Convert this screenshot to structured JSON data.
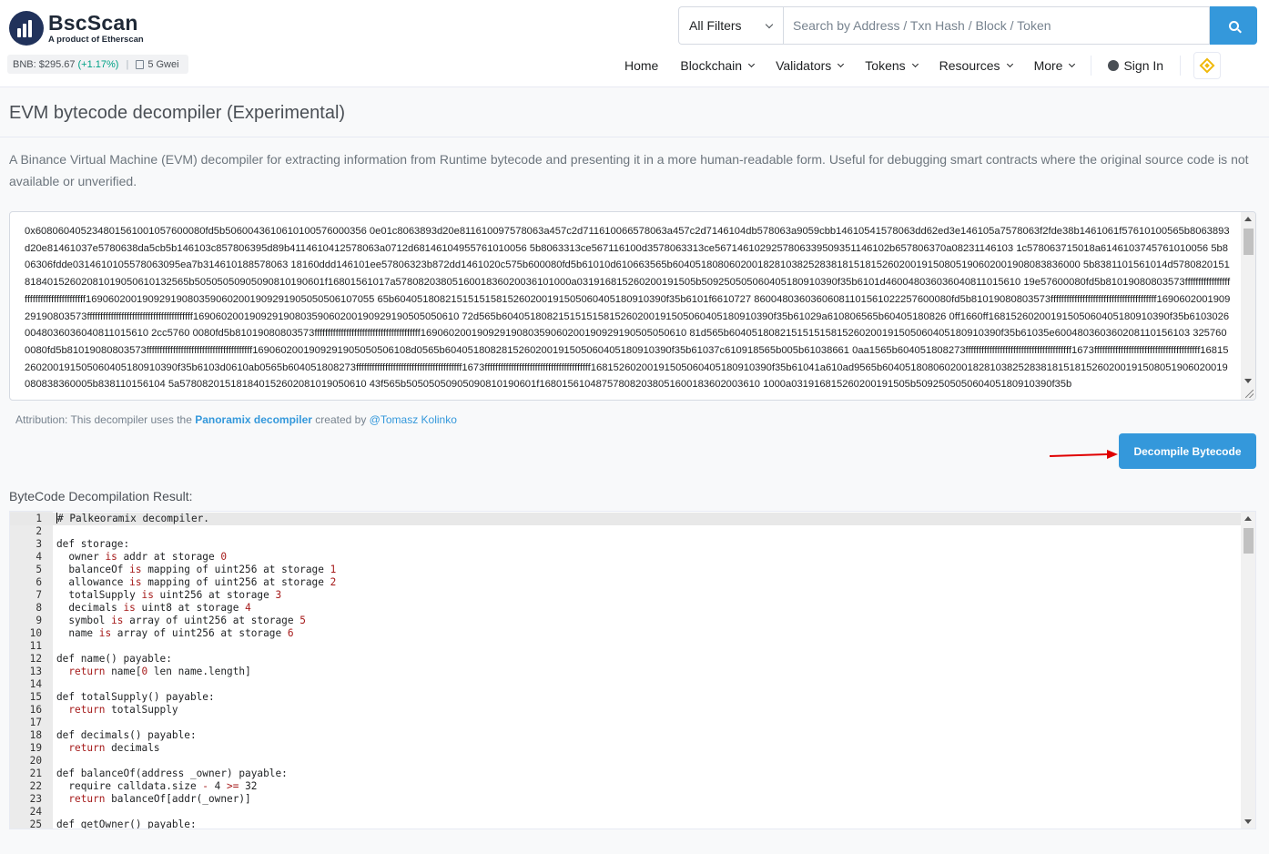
{
  "header": {
    "logo_name": "BscScan",
    "logo_sub": "A product of Etherscan",
    "price_label": "BNB: $295.67",
    "price_change": "(+1.17%)",
    "separator": "|",
    "gas": "5 Gwei",
    "filter_label": "All Filters",
    "search_placeholder": "Search by Address / Txn Hash / Block / Token",
    "nav": {
      "home": "Home",
      "blockchain": "Blockchain",
      "validators": "Validators",
      "tokens": "Tokens",
      "resources": "Resources",
      "more": "More",
      "sign_in": "Sign In"
    }
  },
  "page": {
    "title": "EVM bytecode decompiler (Experimental)",
    "description": "A Binance Virtual Machine (EVM) decompiler for extracting information from Runtime bytecode and presenting it in a more human-readable form. Useful for debugging smart contracts where the original source code is not available or unverified.",
    "bytecode": "0x608060405234801561001057600080fd5b5060043610610100576000356 0e01c8063893d20e811610097578063a457c2d711610066578063a457c2d7146104db578063a9059cbb14610541578063dd62ed3e146105a7578063f2fde38b1461061f57610100565b8063893d20e81461037e5780638da5cb5b146103c857806395d89b4114610412578063a0712d68146104955761010056 5b8063313ce567116100d3578063313ce5671461029257806339509351146102b657806370a08231146103 1c578063715018a6146103745761010056 5b806306fdde0314610105578063095ea7b314610188578063 18160ddd146101ee57806323b872dd1461020c575b600080fd5b61010d610663565b604051808060200182810382528381815181526020019150805190602001908083836000 5b8381101561014d578082015181840152602081019050610132565b50505050905090810190601f16801561017a5780820380516001836020036101000a031916815260200191505b509250505060405180910390f35b6101d460048036036040811015610 19e57600080fd5b81019080803573ffffffffffffffffffffffffffffffffffffffff169060200190929190803590602001909291905050506107055 65b604051808215151515815260200191505060405180910390f35b6101f6610727 86004803603606081101561022257600080fd5b81019080803573ffffffffffffffffffffffffffffffffffffffff169060200190929190803573ffffffffffffffffffffffffffffffffffffffff16906020019092919080359060200190929190505050610 72d565b604051808215151515815260200191505060405180910390f35b61029a610806565b60405180826 0ff1660ff16815260200191505060405180910390f35b61030260048036036040811015610 2cc5760 0080fd5b81019080803573ffffffffffffffffffffffffffffffffffffffff16906020019092919080359060200190929190505050610 81d565b604051808215151515815260200191505060405180910390f35b61035e600480360360208110156103 3257600080fd5b81019080803573ffffffffffffffffffffffffffffffffffffffff1690602001909291905050506108d0565b6040518082815260200191505060405180910390f35b61037c610918565b005b61038661 0aa1565b604051808273ffffffffffffffffffffffffffffffffffffffff1673ffffffffffffffffffffffffffffffffffffffff16815260200191505060405180910390f35b6103d0610ab0565b604051808273ffffffffffffffffffffffffffffffffffffffff1673ffffffffffffffffffffffffffffffffffffffff16815260200191505060405180910390f35b61041a610ad9565b6040518080602001828103825283818151815260200191508051906020019080838360005b838110156104 5a578082015181840152602081019050610 43f565b50505050905090810190601f168015610487578082038051600183602003610 1000a031916815260200191505b509250505060405180910390f35b",
    "attribution_prefix": "Attribution: This decompiler uses the",
    "attribution_link": "Panoramix decompiler",
    "attribution_mid": "created by",
    "attribution_author": "@Tomasz Kolinko",
    "decompile_button": "Decompile Bytecode",
    "result_label": "ByteCode Decompilation Result:"
  },
  "code_lines": [
    {
      "n": "1",
      "t": "# Palkeoramix decompiler. "
    },
    {
      "n": "2",
      "t": ""
    },
    {
      "n": "3",
      "t": "def storage:"
    },
    {
      "n": "4",
      "t": "  owner is addr at storage 0"
    },
    {
      "n": "5",
      "t": "  balanceOf is mapping of uint256 at storage 1"
    },
    {
      "n": "6",
      "t": "  allowance is mapping of uint256 at storage 2"
    },
    {
      "n": "7",
      "t": "  totalSupply is uint256 at storage 3"
    },
    {
      "n": "8",
      "t": "  decimals is uint8 at storage 4"
    },
    {
      "n": "9",
      "t": "  symbol is array of uint256 at storage 5"
    },
    {
      "n": "10",
      "t": "  name is array of uint256 at storage 6"
    },
    {
      "n": "11",
      "t": ""
    },
    {
      "n": "12",
      "t": "def name() payable: "
    },
    {
      "n": "13",
      "t": "  return name[0 len name.length]"
    },
    {
      "n": "14",
      "t": ""
    },
    {
      "n": "15",
      "t": "def totalSupply() payable: "
    },
    {
      "n": "16",
      "t": "  return totalSupply"
    },
    {
      "n": "17",
      "t": ""
    },
    {
      "n": "18",
      "t": "def decimals() payable: "
    },
    {
      "n": "19",
      "t": "  return decimals"
    },
    {
      "n": "20",
      "t": ""
    },
    {
      "n": "21",
      "t": "def balanceOf(address _owner) payable: "
    },
    {
      "n": "22",
      "t": "  require calldata.size - 4 >= 32"
    },
    {
      "n": "23",
      "t": "  return balanceOf[addr(_owner)]"
    },
    {
      "n": "24",
      "t": ""
    },
    {
      "n": "25",
      "t": "def getOwner() payable: "
    }
  ],
  "colors": {
    "accent": "#3498db",
    "positive": "#00a186",
    "brand_yellow": "#f0b90b",
    "annotation_arrow": "#e00000",
    "code_keyword": "#a51a1a"
  },
  "icons": [
    "logo-icon",
    "gas-icon",
    "chevron-down-icon",
    "search-icon",
    "user-icon",
    "bnb-icon",
    "red-arrow-icon",
    "scroll-arrow-icon"
  ]
}
